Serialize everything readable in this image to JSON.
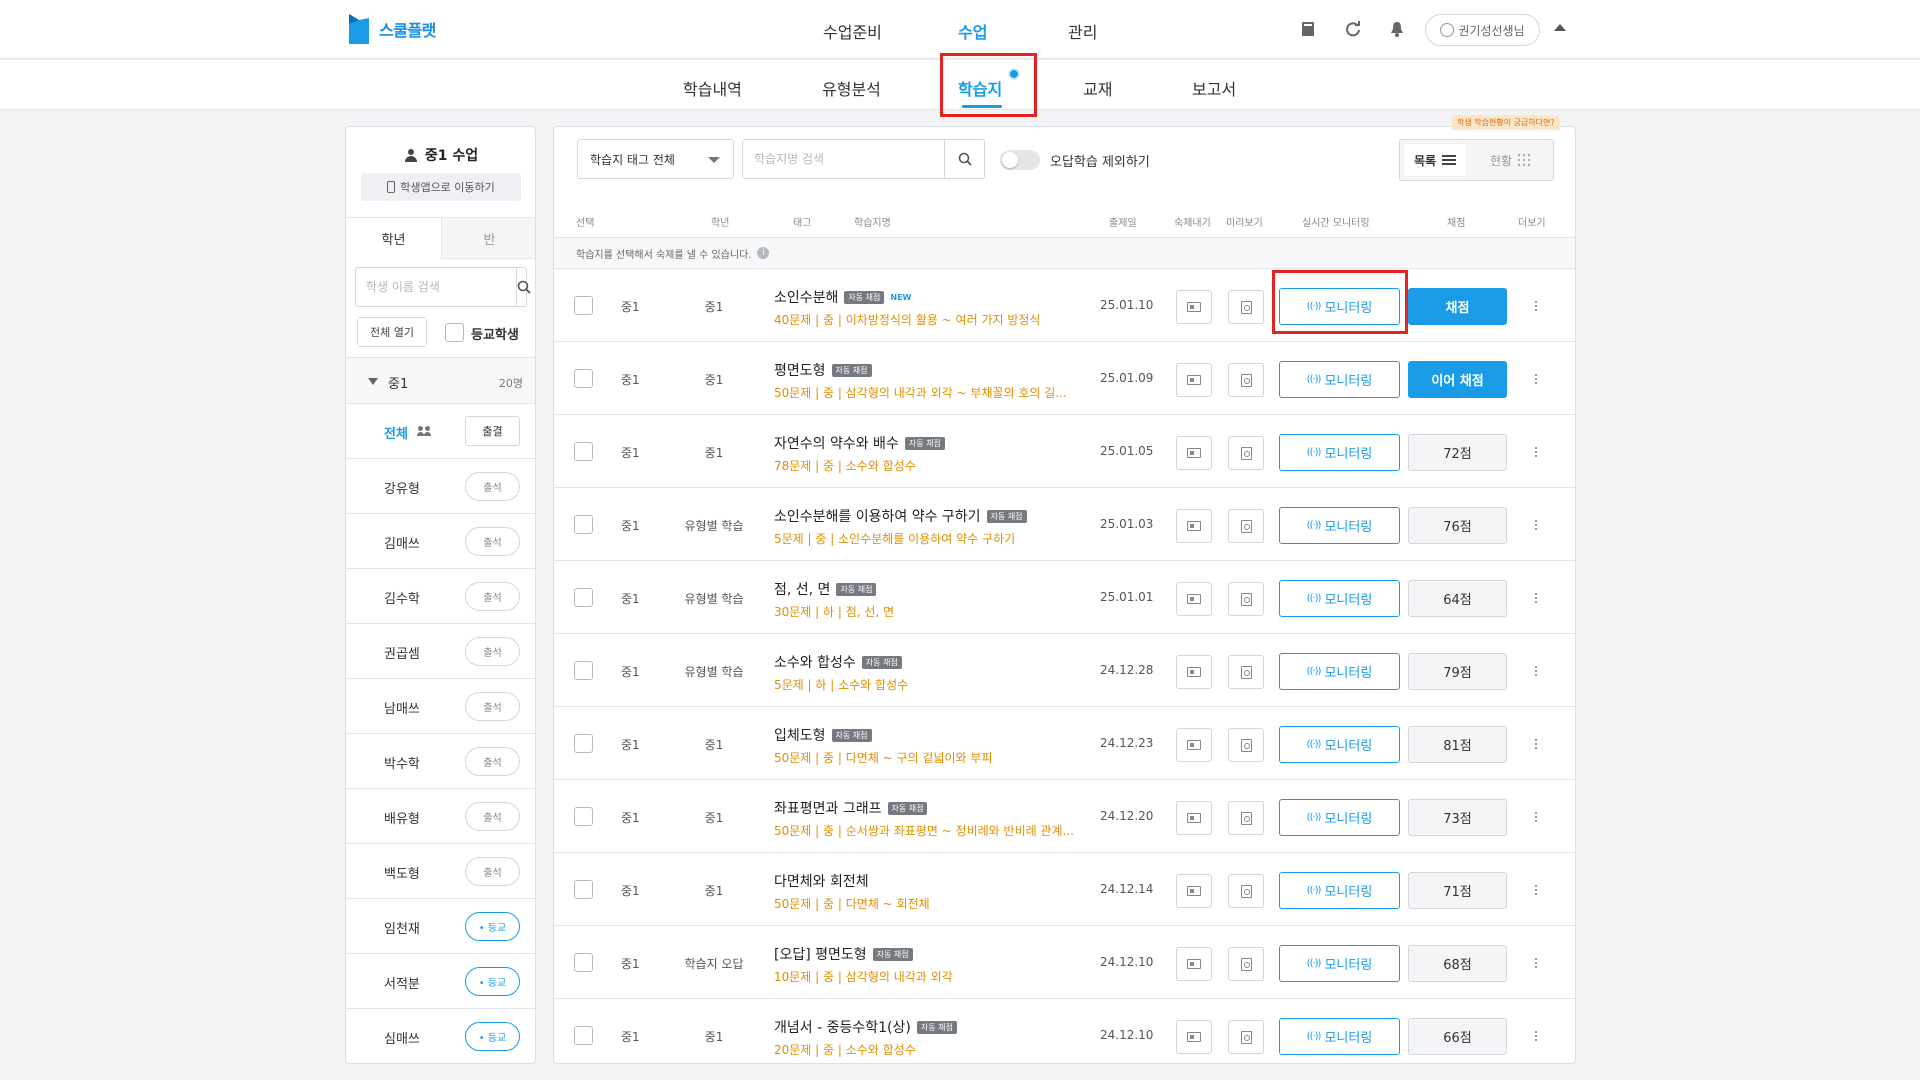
{
  "app": {
    "logo_text": "스쿨플랫"
  },
  "main_nav": [
    {
      "label": "수업준비"
    },
    {
      "label": "수업"
    },
    {
      "label": "관리"
    }
  ],
  "header": {
    "user_name": "권기성선생님"
  },
  "sub_nav": [
    {
      "label": "학습내역"
    },
    {
      "label": "유형분석"
    },
    {
      "label": "학습지"
    },
    {
      "label": "교재"
    },
    {
      "label": "보고서"
    }
  ],
  "sidebar": {
    "title": "중1 수업",
    "student_app_button": "학생앱으로 이동하기",
    "tabs": [
      {
        "label": "학년"
      },
      {
        "label": "반"
      }
    ],
    "search_placeholder": "학생 이름 검색",
    "open_all_button": "전체 열기",
    "school_students_label": "등교학생",
    "grade_group": {
      "label": "중1",
      "count": "20명"
    },
    "all_row": {
      "label": "전체",
      "button": "출결"
    },
    "students": [
      {
        "name": "강유형",
        "status": "출석"
      },
      {
        "name": "김매쓰",
        "status": "출석"
      },
      {
        "name": "김수학",
        "status": "출석"
      },
      {
        "name": "권곱셈",
        "status": "출석"
      },
      {
        "name": "남매쓰",
        "status": "출석"
      },
      {
        "name": "박수학",
        "status": "출석"
      },
      {
        "name": "배유형",
        "status": "출석"
      },
      {
        "name": "백도형",
        "status": "출석"
      },
      {
        "name": "임천재",
        "status": "• 등교"
      },
      {
        "name": "서적분",
        "status": "• 등교"
      },
      {
        "name": "심매쓰",
        "status": "• 등교"
      }
    ]
  },
  "toolbar": {
    "tooltip": "학생 학습현황이 궁금하다면?",
    "tag_filter": "학습지 태그 전체",
    "search_placeholder": "학습지명 검색",
    "exclude_wrong_label": "오답학습 제외하기",
    "view_list": "목록",
    "view_status": "현황"
  },
  "table": {
    "headers": {
      "select": "선택",
      "grade": "학년",
      "tag": "태그",
      "name": "학습지명",
      "date": "출제일",
      "homework": "숙제내기",
      "preview": "미리보기",
      "monitoring": "실시간 모니터링",
      "grading": "채점",
      "more": "더보기"
    },
    "notice": "학습지를 선택해서 숙제를 낼 수 있습니다.",
    "info_glyph": "i",
    "auto_badge": "자동 채점",
    "new_badge": "NEW",
    "monitor_label": "모니터링",
    "monitor_glyph": "((·))",
    "rows": [
      {
        "grade": "중1",
        "tag": "중1",
        "name": "소인수분해",
        "auto": true,
        "is_new": true,
        "desc": "40문제 | 중 | 이차방정식의 활용 ~ 여러 가지 방정식",
        "date": "25.01.10",
        "score": "채점",
        "primary": true
      },
      {
        "grade": "중1",
        "tag": "중1",
        "name": "평면도형",
        "auto": true,
        "is_new": false,
        "desc": "50문제 | 중 | 삼각형의 내각과 외각 ~ 부채꼴의 호의 길...",
        "date": "25.01.09",
        "score": "이어 채점",
        "primary": true
      },
      {
        "grade": "중1",
        "tag": "중1",
        "name": "자연수의 약수와 배수",
        "auto": true,
        "is_new": false,
        "desc": "78문제 | 중 | 소수와 합성수",
        "date": "25.01.05",
        "score": "72점",
        "primary": false
      },
      {
        "grade": "중1",
        "tag": "유형별 학습",
        "name": "소인수분해를 이용하여 약수 구하기",
        "auto": true,
        "is_new": false,
        "desc": "5문제 | 중 | 소인수분해를 이용하여 약수 구하기",
        "date": "25.01.03",
        "score": "76점",
        "primary": false
      },
      {
        "grade": "중1",
        "tag": "유형별 학습",
        "name": "점, 선, 면",
        "auto": true,
        "is_new": false,
        "desc": "30문제 | 하 | 점, 선, 면",
        "date": "25.01.01",
        "score": "64점",
        "primary": false
      },
      {
        "grade": "중1",
        "tag": "유형별 학습",
        "name": "소수와 합성수",
        "auto": true,
        "is_new": false,
        "desc": "5문제 | 하 | 소수와 합성수",
        "date": "24.12.28",
        "score": "79점",
        "primary": false
      },
      {
        "grade": "중1",
        "tag": "중1",
        "name": "입체도형",
        "auto": true,
        "is_new": false,
        "desc": "50문제 | 중 | 다면체 ~ 구의 겉넓이와 부피",
        "date": "24.12.23",
        "score": "81점",
        "primary": false
      },
      {
        "grade": "중1",
        "tag": "중1",
        "name": "좌표평면과 그래프",
        "auto": true,
        "is_new": false,
        "desc": "50문제 | 중 | 순서쌍과 좌표평면 ~ 정비례와 반비례 관계...",
        "date": "24.12.20",
        "score": "73점",
        "primary": false
      },
      {
        "grade": "중1",
        "tag": "중1",
        "name": "다면체와 회전체",
        "auto": false,
        "is_new": false,
        "desc": "50문제 | 중 | 다면체 ~ 회전체",
        "date": "24.12.14",
        "score": "71점",
        "primary": false
      },
      {
        "grade": "중1",
        "tag": "학습지 오답",
        "name": "[오답] 평면도형",
        "auto": true,
        "is_new": false,
        "desc": "10문제 | 중 | 삼각형의 내각과 외각",
        "date": "24.12.10",
        "score": "68점",
        "primary": false
      },
      {
        "grade": "중1",
        "tag": "중1",
        "name": "개념서 - 중등수학1(상)",
        "auto": true,
        "is_new": false,
        "desc": "20문제 | 중 | 소수와 합성수",
        "date": "24.12.10",
        "score": "66점",
        "primary": false
      }
    ]
  }
}
